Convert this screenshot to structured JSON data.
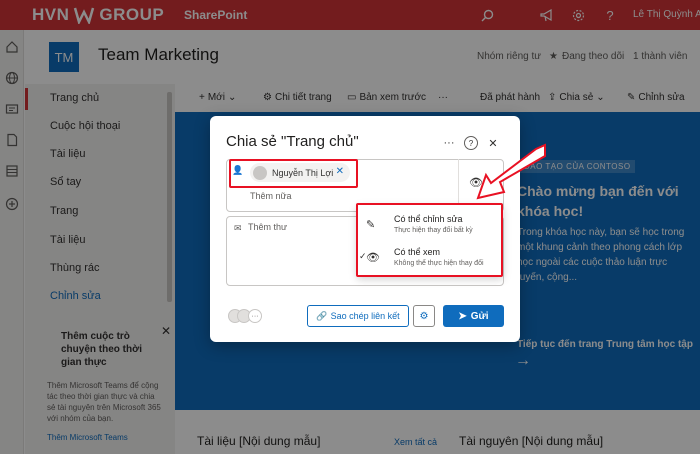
{
  "suite": {
    "brand_left": "HVN",
    "brand_right": "GROUP",
    "app_name": "SharePoint",
    "user_name": "Lê Thị Quỳnh Anh",
    "bar_color": "#d13438"
  },
  "site": {
    "logo_text": "TM",
    "title": "Team Marketing",
    "privacy": "Nhóm riêng tư",
    "following": "Đang theo dõi",
    "members_count": "1 thành viên"
  },
  "nav": {
    "items": [
      "Trang chủ",
      "Cuộc hội thoại",
      "Tài liệu",
      "Sổ tay",
      "Trang",
      "Tài liệu",
      "Thùng rác"
    ],
    "edit": "Chỉnh sửa"
  },
  "teams_card": {
    "title": "Thêm cuộc trò chuyện theo thời gian thực",
    "description": "Thêm Microsoft Teams để cộng tác theo thời gian thực và chia sẻ tài nguyên trên Microsoft 365 với nhóm của bạn.",
    "link": "Thêm Microsoft Teams"
  },
  "command_bar": {
    "new": "Mới",
    "page_details": "Chi tiết trang",
    "preview": "Bản xem trước",
    "published": "Đã phát hành",
    "share": "Chia sẻ",
    "edit": "Chỉnh sửa"
  },
  "hero": {
    "badge": "ĐÀO TẠO CỦA CONTOSO",
    "title": "Chào mừng bạn đến với khóa học!",
    "text": "Trong khóa học này, bạn sẽ học trong một khung cảnh theo phong cách lớp học ngoài các cuộc thảo luận trực tuyến, cộng...",
    "link": "Tiếp tục đến trang Trung tâm học tập"
  },
  "bottom": {
    "docs_title": "Tài liệu [Nội dung mẫu]",
    "see_all": "Xem tất cả",
    "resources_title": "Tài nguyên [Nội dung mẫu]"
  },
  "dialog": {
    "title": "Chia sẻ \"Trang chủ\"",
    "recipient": "Nguyễn Thị Lợi",
    "add_more": "Thêm nữa",
    "message_placeholder": "Thêm thư",
    "copy_link": "Sao chép liên kết",
    "send": "Gửi"
  },
  "permissions": [
    {
      "title": "Có thể chỉnh sửa",
      "subtitle": "Thực hiện thay đổi bất kỳ",
      "icon": "pencil-icon",
      "selected": false
    },
    {
      "title": "Có thể xem",
      "subtitle": "Không thể thực hiện thay đổi",
      "icon": "eye-icon",
      "selected": true
    }
  ],
  "colors": {
    "accent": "#0f6cbd",
    "highlight": "#e81123"
  }
}
